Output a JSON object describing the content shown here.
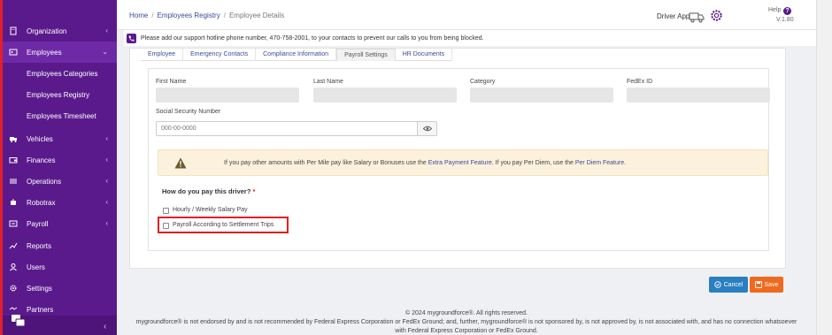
{
  "sidebar": {
    "items": [
      {
        "label": "Organization",
        "icon": "building-icon",
        "has_chevron": true
      },
      {
        "label": "Employees",
        "icon": "id-card-icon",
        "has_chevron": true
      },
      {
        "label": "Vehicles",
        "icon": "truck-icon",
        "has_chevron": true
      },
      {
        "label": "Finances",
        "icon": "wallet-icon",
        "has_chevron": true
      },
      {
        "label": "Operations",
        "icon": "operations-icon",
        "has_chevron": true
      },
      {
        "label": "Robotrax",
        "icon": "robot-icon",
        "has_chevron": true
      },
      {
        "label": "Payroll",
        "icon": "payroll-icon",
        "has_chevron": true
      },
      {
        "label": "Reports",
        "icon": "chart-icon",
        "has_chevron": false
      },
      {
        "label": "Users",
        "icon": "user-icon",
        "has_chevron": false
      },
      {
        "label": "Settings",
        "icon": "gear-icon",
        "has_chevron": false
      },
      {
        "label": "Partners",
        "icon": "handshake-icon",
        "has_chevron": false
      }
    ],
    "sub_items": [
      "Employees Categories",
      "Employees Registry",
      "Employees Timesheet"
    ],
    "chevron": "‹",
    "collapse_icon": "‹"
  },
  "header": {
    "breadcrumb": [
      "Home",
      "Employees Registry",
      "Employee Details"
    ],
    "breadcrumb_sep": "/",
    "driver_app": "Driver App",
    "help": "Help",
    "help_icon_text": "?",
    "version": "V.1.80"
  },
  "notice": {
    "text": "Please add our support hotline phone number, 470-758-2001, to your contacts to prevent our calls to you from being blocked."
  },
  "tabs": [
    "Employee",
    "Emergency Contacts",
    "Compliance Information",
    "Payroll Settings",
    "HR Documents"
  ],
  "active_tab": "Payroll Settings",
  "form": {
    "first_name_label": "First Name",
    "last_name_label": "Last Name",
    "category_label": "Category",
    "fedex_id_label": "FedEx ID",
    "ssn_label": "Social Security Number",
    "ssn_placeholder": "000-00-0000"
  },
  "warning": {
    "text_before": "If you pay other amounts with Per Mile pay like Salary or Bonuses use the ",
    "link1": "Extra Payment Feature",
    "text_middle": ". If you pay Per Diem, use the ",
    "link2": "Per Diem Feature",
    "text_after": "."
  },
  "question": {
    "label": "How do you pay this driver?",
    "required": "*",
    "options": [
      "Hourly / Weekly Salary Pay",
      "Payroll According to Settlement Trips"
    ]
  },
  "buttons": {
    "cancel": "Cancel",
    "save": "Save"
  },
  "footer": {
    "line1": "© 2024 mygroundforce®. All rights reserved.",
    "line2": "mygroundforce® is not endorsed by and is not recommended by Federal Express Corporation or FedEx Ground; and, further, mygroundforce® is not sponsored by, is not approved by, is not associated with, and has no connection whatsoever",
    "line3": "with Federal Express Corporation or FedEx Ground."
  },
  "colors": {
    "sidebar_bg": "#5a1a8c",
    "accent_red": "#e0202a",
    "link_blue": "#3b4a9a",
    "cancel_blue": "#2a7fc0",
    "save_orange": "#f06a1e",
    "warning_bg": "#fcf1dc"
  }
}
